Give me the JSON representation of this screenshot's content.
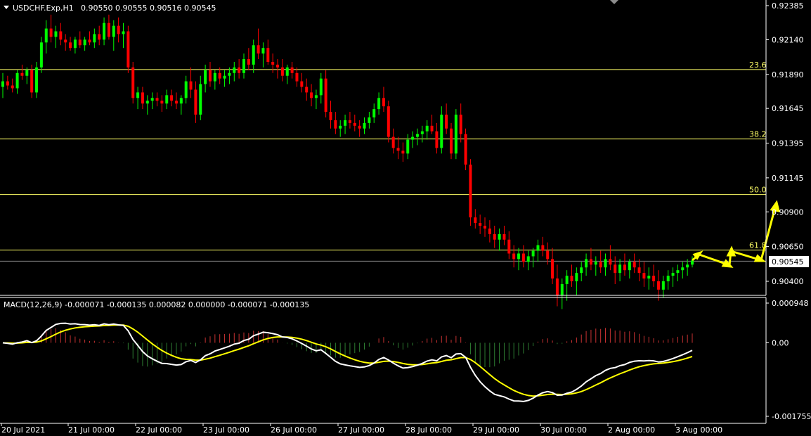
{
  "header": {
    "symbol": "USDCHF.Exp,H1",
    "ohlc": "0.90550 0.90555 0.90516 0.90545"
  },
  "macd_header": {
    "label": "MACD(12,26,9)",
    "values": "-0.000071 -0.000135 0.000082 0.000000 -0.000071 -0.000135"
  },
  "colors": {
    "background": "#000000",
    "bull": "#00ff00",
    "bear": "#ff0000",
    "fib": "#ffff66",
    "arrow": "#ffff00",
    "macd_line": "#ffffff",
    "signal_line": "#ffff00",
    "hist_pos": "#c83232",
    "hist_neg": "#2e7d32",
    "current_line": "#8c8c8c"
  },
  "chart_data": {
    "type": "candlestick",
    "price_axis": {
      "ticks": [
        "0.92385",
        "0.92140",
        "0.91890",
        "0.91645",
        "0.91395",
        "0.91145",
        "0.90900",
        "0.90650",
        "0.90400"
      ],
      "ylim": [
        0.9031,
        0.9243
      ],
      "current_price": "0.90545"
    },
    "fibonacci": [
      {
        "label": "23.6",
        "price": 0.91925
      },
      {
        "label": "38.2",
        "price": 0.91425
      },
      {
        "label": "50.0",
        "price": 0.91025
      },
      {
        "label": "61.8",
        "price": 0.90625
      }
    ],
    "x_ticks": [
      "20 Jul 2021",
      "21 Jul 00:00",
      "22 Jul 00:00",
      "23 Jul 00:00",
      "26 Jul 00:00",
      "27 Jul 00:00",
      "28 Jul 00:00",
      "29 Jul 00:00",
      "30 Jul 00:00",
      "2 Aug 00:00",
      "3 Aug 00:00"
    ],
    "candles": [
      [
        0.918,
        0.919,
        0.9172,
        0.9184
      ],
      [
        0.9184,
        0.9188,
        0.9178,
        0.9181
      ],
      [
        0.9181,
        0.9186,
        0.9176,
        0.9179
      ],
      [
        0.9179,
        0.9192,
        0.9175,
        0.919
      ],
      [
        0.919,
        0.9196,
        0.9185,
        0.9188
      ],
      [
        0.9188,
        0.9194,
        0.9182,
        0.9192
      ],
      [
        0.9192,
        0.9196,
        0.9172,
        0.9176
      ],
      [
        0.9176,
        0.9198,
        0.9172,
        0.9194
      ],
      [
        0.9194,
        0.9216,
        0.919,
        0.9212
      ],
      [
        0.9212,
        0.9228,
        0.9204,
        0.9222
      ],
      [
        0.9222,
        0.9232,
        0.9212,
        0.9216
      ],
      [
        0.9216,
        0.9224,
        0.9208,
        0.922
      ],
      [
        0.922,
        0.9226,
        0.921,
        0.9214
      ],
      [
        0.9214,
        0.9218,
        0.9206,
        0.9212
      ],
      [
        0.9212,
        0.9216,
        0.9206,
        0.9208
      ],
      [
        0.9208,
        0.9216,
        0.9204,
        0.9214
      ],
      [
        0.9214,
        0.922,
        0.9208,
        0.921
      ],
      [
        0.921,
        0.9216,
        0.9206,
        0.9214
      ],
      [
        0.9214,
        0.922,
        0.921,
        0.9212
      ],
      [
        0.9212,
        0.9222,
        0.9208,
        0.9218
      ],
      [
        0.9218,
        0.9224,
        0.921,
        0.9214
      ],
      [
        0.9214,
        0.923,
        0.921,
        0.9226
      ],
      [
        0.9226,
        0.9232,
        0.9214,
        0.9216
      ],
      [
        0.9216,
        0.9228,
        0.9206,
        0.9224
      ],
      [
        0.9224,
        0.923,
        0.9212,
        0.9218
      ],
      [
        0.9218,
        0.9226,
        0.9208,
        0.922
      ],
      [
        0.922,
        0.9224,
        0.919,
        0.9194
      ],
      [
        0.9194,
        0.9198,
        0.9168,
        0.9172
      ],
      [
        0.9172,
        0.918,
        0.9164,
        0.9176
      ],
      [
        0.9176,
        0.918,
        0.9164,
        0.9168
      ],
      [
        0.9168,
        0.9174,
        0.916,
        0.917
      ],
      [
        0.917,
        0.9176,
        0.9164,
        0.9172
      ],
      [
        0.9172,
        0.9176,
        0.9166,
        0.917
      ],
      [
        0.917,
        0.9174,
        0.9162,
        0.9168
      ],
      [
        0.9168,
        0.9178,
        0.9164,
        0.9174
      ],
      [
        0.9174,
        0.9178,
        0.9166,
        0.917
      ],
      [
        0.917,
        0.9176,
        0.9164,
        0.9168
      ],
      [
        0.9168,
        0.9174,
        0.916,
        0.9172
      ],
      [
        0.9172,
        0.9188,
        0.9168,
        0.9184
      ],
      [
        0.9184,
        0.9194,
        0.9172,
        0.9178
      ],
      [
        0.9178,
        0.9184,
        0.9154,
        0.916
      ],
      [
        0.916,
        0.9188,
        0.9156,
        0.9182
      ],
      [
        0.9182,
        0.9196,
        0.9176,
        0.9192
      ],
      [
        0.9192,
        0.9198,
        0.918,
        0.9184
      ],
      [
        0.9184,
        0.9192,
        0.9178,
        0.919
      ],
      [
        0.919,
        0.9194,
        0.9182,
        0.9186
      ],
      [
        0.9186,
        0.9192,
        0.918,
        0.9188
      ],
      [
        0.9188,
        0.9194,
        0.9182,
        0.919
      ],
      [
        0.919,
        0.9198,
        0.9184,
        0.9194
      ],
      [
        0.9194,
        0.92,
        0.9186,
        0.919
      ],
      [
        0.919,
        0.9204,
        0.9186,
        0.92
      ],
      [
        0.92,
        0.9208,
        0.9192,
        0.9196
      ],
      [
        0.9196,
        0.9214,
        0.919,
        0.921
      ],
      [
        0.921,
        0.9222,
        0.92,
        0.9204
      ],
      [
        0.9204,
        0.9212,
        0.9194,
        0.9208
      ],
      [
        0.9208,
        0.9214,
        0.9196,
        0.9198
      ],
      [
        0.9198,
        0.9204,
        0.919,
        0.9196
      ],
      [
        0.9196,
        0.92,
        0.9186,
        0.9194
      ],
      [
        0.9194,
        0.92,
        0.9184,
        0.9188
      ],
      [
        0.9188,
        0.9196,
        0.9182,
        0.9194
      ],
      [
        0.9194,
        0.9198,
        0.9186,
        0.919
      ],
      [
        0.919,
        0.9194,
        0.918,
        0.9184
      ],
      [
        0.9184,
        0.919,
        0.9176,
        0.918
      ],
      [
        0.918,
        0.9186,
        0.917,
        0.9176
      ],
      [
        0.9176,
        0.9182,
        0.9166,
        0.9172
      ],
      [
        0.9172,
        0.9178,
        0.9164,
        0.9174
      ],
      [
        0.9174,
        0.919,
        0.9168,
        0.9186
      ],
      [
        0.9186,
        0.9192,
        0.9158,
        0.9162
      ],
      [
        0.9162,
        0.917,
        0.915,
        0.9156
      ],
      [
        0.9156,
        0.9162,
        0.9146,
        0.915
      ],
      [
        0.915,
        0.9156,
        0.9144,
        0.9152
      ],
      [
        0.9152,
        0.916,
        0.9146,
        0.9156
      ],
      [
        0.9156,
        0.9162,
        0.915,
        0.9154
      ],
      [
        0.9154,
        0.916,
        0.9148,
        0.9152
      ],
      [
        0.9152,
        0.9156,
        0.9144,
        0.915
      ],
      [
        0.915,
        0.9158,
        0.9146,
        0.9154
      ],
      [
        0.9154,
        0.9162,
        0.915,
        0.9158
      ],
      [
        0.9158,
        0.9168,
        0.9154,
        0.9164
      ],
      [
        0.9164,
        0.9176,
        0.916,
        0.9172
      ],
      [
        0.9172,
        0.918,
        0.9162,
        0.9166
      ],
      [
        0.9166,
        0.917,
        0.914,
        0.9144
      ],
      [
        0.9144,
        0.915,
        0.9132,
        0.9136
      ],
      [
        0.9136,
        0.9144,
        0.9128,
        0.9134
      ],
      [
        0.9134,
        0.914,
        0.9126,
        0.9132
      ],
      [
        0.9132,
        0.9146,
        0.9128,
        0.9142
      ],
      [
        0.9142,
        0.9148,
        0.9136,
        0.9144
      ],
      [
        0.9144,
        0.915,
        0.9138,
        0.9146
      ],
      [
        0.9146,
        0.9152,
        0.914,
        0.9148
      ],
      [
        0.9148,
        0.9156,
        0.9142,
        0.9152
      ],
      [
        0.9152,
        0.916,
        0.9146,
        0.9148
      ],
      [
        0.9148,
        0.9154,
        0.9132,
        0.9136
      ],
      [
        0.9136,
        0.9166,
        0.9132,
        0.916
      ],
      [
        0.916,
        0.9168,
        0.9146,
        0.915
      ],
      [
        0.915,
        0.9154,
        0.9128,
        0.9132
      ],
      [
        0.9132,
        0.9164,
        0.9128,
        0.916
      ],
      [
        0.916,
        0.9168,
        0.914,
        0.9146
      ],
      [
        0.9146,
        0.915,
        0.912,
        0.9124
      ],
      [
        0.9124,
        0.9128,
        0.908,
        0.9086
      ],
      [
        0.9086,
        0.9092,
        0.9078,
        0.9082
      ],
      [
        0.9082,
        0.9088,
        0.9074,
        0.908
      ],
      [
        0.908,
        0.9086,
        0.9072,
        0.9078
      ],
      [
        0.9078,
        0.9084,
        0.9068,
        0.9074
      ],
      [
        0.9074,
        0.908,
        0.9064,
        0.907
      ],
      [
        0.907,
        0.9078,
        0.9062,
        0.9074
      ],
      [
        0.9074,
        0.908,
        0.9066,
        0.907
      ],
      [
        0.907,
        0.9076,
        0.9056,
        0.906
      ],
      [
        0.906,
        0.9066,
        0.905,
        0.9056
      ],
      [
        0.9056,
        0.9064,
        0.9048,
        0.906
      ],
      [
        0.906,
        0.9066,
        0.905,
        0.9054
      ],
      [
        0.9054,
        0.9062,
        0.9048,
        0.9058
      ],
      [
        0.9058,
        0.9064,
        0.905,
        0.9062
      ],
      [
        0.9062,
        0.907,
        0.9054,
        0.9066
      ],
      [
        0.9066,
        0.9072,
        0.9058,
        0.9062
      ],
      [
        0.9062,
        0.9068,
        0.9052,
        0.9056
      ],
      [
        0.9056,
        0.9064,
        0.9038,
        0.9042
      ],
      [
        0.9042,
        0.9052,
        0.9022,
        0.903
      ],
      [
        0.903,
        0.9042,
        0.902,
        0.9038
      ],
      [
        0.9038,
        0.9048,
        0.9026,
        0.9044
      ],
      [
        0.9044,
        0.9052,
        0.9036,
        0.904
      ],
      [
        0.904,
        0.905,
        0.903,
        0.9046
      ],
      [
        0.9046,
        0.9054,
        0.904,
        0.905
      ],
      [
        0.905,
        0.906,
        0.9044,
        0.9056
      ],
      [
        0.9056,
        0.9064,
        0.9048,
        0.9052
      ],
      [
        0.9052,
        0.9058,
        0.9044,
        0.9054
      ],
      [
        0.9054,
        0.9062,
        0.9046,
        0.905
      ],
      [
        0.905,
        0.906,
        0.9044,
        0.9056
      ],
      [
        0.9056,
        0.9066,
        0.9048,
        0.9052
      ],
      [
        0.9052,
        0.9058,
        0.9038,
        0.9046
      ],
      [
        0.9046,
        0.9056,
        0.904,
        0.9052
      ],
      [
        0.9052,
        0.906,
        0.9044,
        0.9048
      ],
      [
        0.9048,
        0.9056,
        0.9042,
        0.9054
      ],
      [
        0.9054,
        0.906,
        0.9046,
        0.905
      ],
      [
        0.905,
        0.9056,
        0.904,
        0.9046
      ],
      [
        0.9046,
        0.9054,
        0.9036,
        0.9042
      ],
      [
        0.9042,
        0.905,
        0.9034,
        0.9044
      ],
      [
        0.9044,
        0.9052,
        0.9036,
        0.904
      ],
      [
        0.904,
        0.9048,
        0.9026,
        0.9034
      ],
      [
        0.9034,
        0.9044,
        0.9028,
        0.904
      ],
      [
        0.904,
        0.9048,
        0.9034,
        0.9044
      ],
      [
        0.9044,
        0.905,
        0.9036,
        0.9046
      ],
      [
        0.9046,
        0.9052,
        0.904,
        0.9048
      ],
      [
        0.9048,
        0.9054,
        0.9042,
        0.905
      ],
      [
        0.905,
        0.9056,
        0.9044,
        0.9052
      ],
      [
        0.9052,
        0.9058,
        0.905,
        0.9055
      ]
    ],
    "macd_axis": {
      "ticks": [
        "0.000948",
        "0.00",
        "-0.001755"
      ],
      "ylim": [
        -0.00195,
        0.00115
      ]
    }
  }
}
